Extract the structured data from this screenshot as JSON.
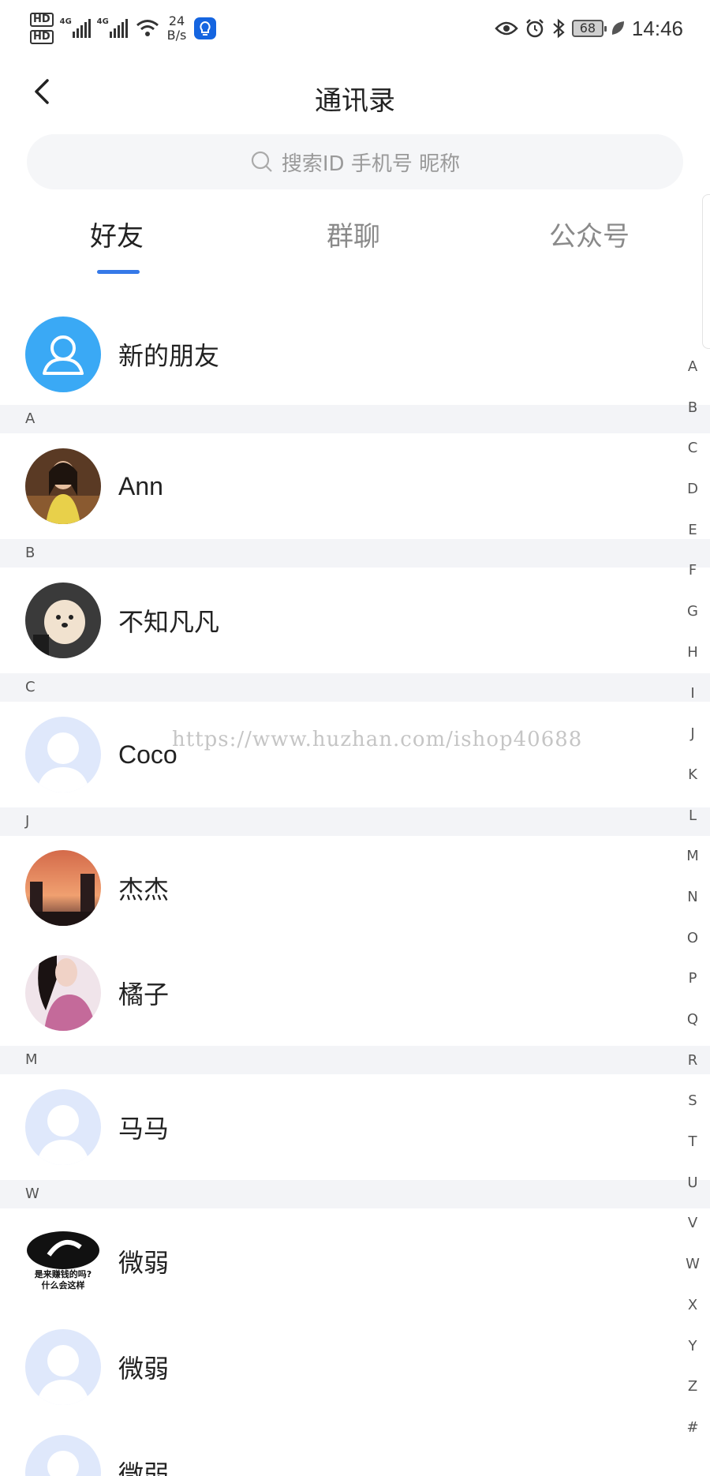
{
  "status": {
    "hd1": "HD",
    "hd2": "HD",
    "net1": "4G",
    "net2": "4G",
    "speed_value": "24",
    "speed_unit": "B/s",
    "battery": "68",
    "time": "14:46"
  },
  "header": {
    "title": "通讯录"
  },
  "search": {
    "placeholder": "搜索ID 手机号 昵称"
  },
  "tabs": [
    {
      "label": "好友",
      "active": true
    },
    {
      "label": "群聊",
      "active": false
    },
    {
      "label": "公众号",
      "active": false
    }
  ],
  "new_friends": {
    "label": "新的朋友"
  },
  "sections": [
    {
      "letter": "A",
      "contacts": [
        {
          "name": "Ann",
          "avatar": "photo-girl-icon"
        }
      ]
    },
    {
      "letter": "B",
      "contacts": [
        {
          "name": "不知凡凡",
          "avatar": "photo-dog-icon"
        }
      ]
    },
    {
      "letter": "C",
      "contacts": [
        {
          "name": "Coco",
          "avatar": "default-avatar-icon"
        }
      ]
    },
    {
      "letter": "J",
      "contacts": [
        {
          "name": "杰杰",
          "avatar": "photo-sunset-icon"
        },
        {
          "name": "橘子",
          "avatar": "photo-portrait-icon"
        }
      ]
    },
    {
      "letter": "M",
      "contacts": [
        {
          "name": "马马",
          "avatar": "default-avatar-icon"
        }
      ]
    },
    {
      "letter": "W",
      "contacts": [
        {
          "name": "微弱",
          "avatar": "meme-avatar-icon"
        },
        {
          "name": "微弱",
          "avatar": "default-avatar-icon"
        },
        {
          "name": "微弱",
          "avatar": "default-avatar-icon"
        }
      ]
    }
  ],
  "meme_text": {
    "line1": "是来赚钱的吗?",
    "line2": "什么会这样"
  },
  "index_letters": [
    "A",
    "B",
    "C",
    "D",
    "E",
    "F",
    "G",
    "H",
    "I",
    "J",
    "K",
    "L",
    "M",
    "N",
    "O",
    "P",
    "Q",
    "R",
    "S",
    "T",
    "U",
    "V",
    "W",
    "X",
    "Y",
    "Z",
    "#"
  ],
  "watermark": "https://www.huzhan.com/ishop40688",
  "colors": {
    "accent": "#3579e8",
    "new_friend_bg": "#3aa9f5",
    "section_bg": "#f3f4f7"
  }
}
